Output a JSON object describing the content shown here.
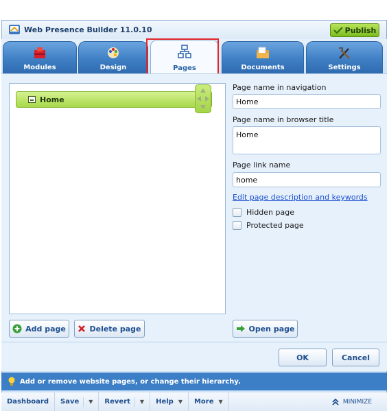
{
  "app": {
    "title": "Web Presence Builder 11.0.10",
    "publish_label": "Publish"
  },
  "tabs": [
    {
      "label": "Modules",
      "icon": "modules-icon"
    },
    {
      "label": "Design",
      "icon": "palette-icon"
    },
    {
      "label": "Pages",
      "icon": "sitemap-icon",
      "active": true
    },
    {
      "label": "Documents",
      "icon": "documents-icon"
    },
    {
      "label": "Settings",
      "icon": "tools-icon"
    }
  ],
  "tree": {
    "nodes": [
      {
        "label": "Home"
      }
    ]
  },
  "form": {
    "nav_name_label": "Page name in navigation",
    "nav_name_value": "Home",
    "browser_title_label": "Page name in browser title",
    "browser_title_value": "Home",
    "link_name_label": "Page link name",
    "link_name_value": "home",
    "edit_desc_link": "Edit page description and keywords",
    "hidden_label": "Hidden page",
    "protected_label": "Protected page"
  },
  "buttons": {
    "add_page": "Add page",
    "delete_page": "Delete page",
    "open_page": "Open page",
    "ok": "OK",
    "cancel": "Cancel"
  },
  "hint": "Add or remove website pages, or change their hierarchy.",
  "bottom_bar": {
    "dashboard": "Dashboard",
    "save": "Save",
    "revert": "Revert",
    "help": "Help",
    "more": "More",
    "minimize": "MINIMIZE"
  },
  "colors": {
    "tab_blue": "#3f7fc4",
    "publish_green": "#7cbc1f",
    "node_green": "#a8d94a",
    "hint_blue": "#3c7fc6",
    "highlight_red": "#e5262a"
  }
}
